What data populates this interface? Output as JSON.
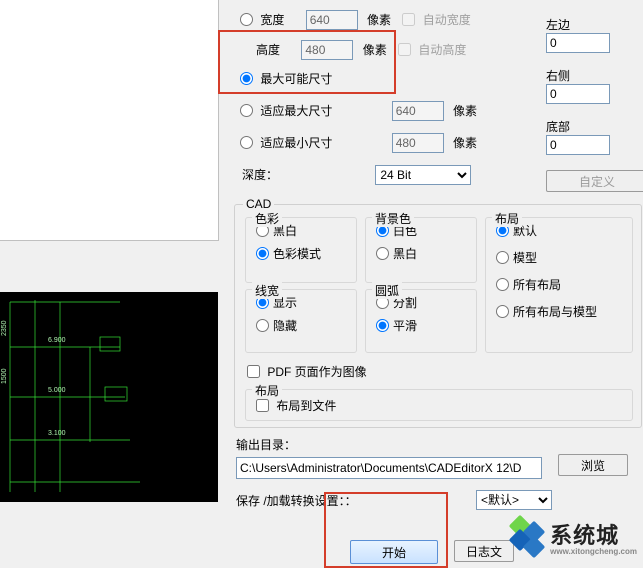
{
  "size_group": {
    "width_label": "宽度",
    "width_value": "640",
    "width_unit": "像素",
    "auto_width": "自动宽度",
    "height_label": "高度",
    "height_value": "480",
    "height_unit": "像素",
    "auto_height": "自动高度",
    "max_possible": "最大可能尺寸",
    "fit_max": "适应最大尺寸",
    "fit_max_value": "640",
    "fit_unit": "像素",
    "fit_min": "适应最小尺寸",
    "fit_min_value": "480",
    "depth_label": "深度：",
    "depth_value": "24 Bit"
  },
  "margins": {
    "left_label": "左边",
    "left_value": "0",
    "right_label": "右侧",
    "right_value": "0",
    "bottom_label": "底部",
    "bottom_value": "0",
    "custom_btn": "自定义"
  },
  "cad": {
    "title": "CAD",
    "color": {
      "title": "色彩",
      "bw": "黑白",
      "color_mode": "色彩模式"
    },
    "bg": {
      "title": "背景色",
      "white": "白色",
      "black": "黑白"
    },
    "layout": {
      "title": "布局",
      "default": "默认",
      "model": "模型",
      "all_layouts": "所有布局",
      "all_layouts_model": "所有布局与模型"
    },
    "lw": {
      "title": "线宽",
      "show": "显示",
      "hide": "隐藏"
    },
    "arc": {
      "title": "圆弧",
      "split": "分割",
      "smooth": "平滑"
    },
    "pdf_as_image": "PDF 页面作为图像",
    "layout_section": {
      "title": "布局",
      "layout_to_file": "布局到文件"
    }
  },
  "output": {
    "dir_label": "输出目录：",
    "dir_value": "C:\\Users\\Administrator\\Documents\\CADEditorX 12\\D",
    "browse": "浏览"
  },
  "convert": {
    "label": "保存 /加载转换设置：：",
    "preset": "<默认>",
    "start": "开始",
    "log": "日志文"
  },
  "watermark": {
    "name": "系统城",
    "sub": "www.xitongcheng.com"
  }
}
